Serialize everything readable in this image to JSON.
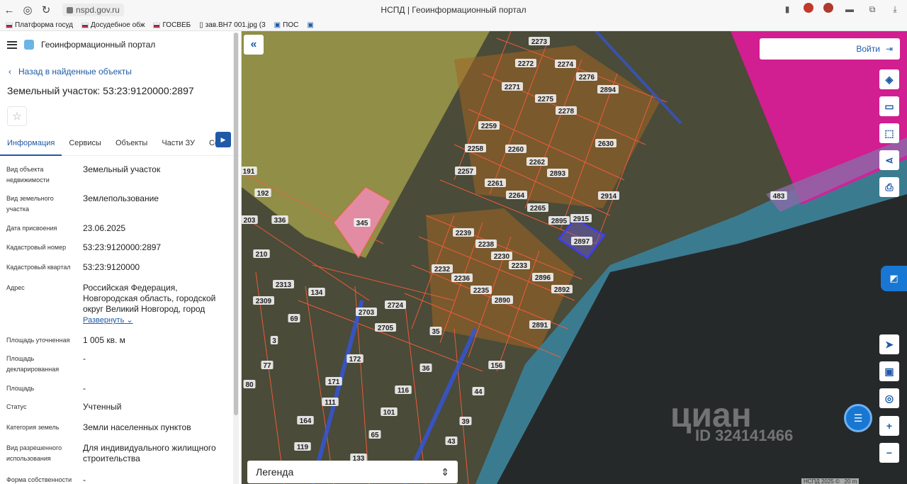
{
  "browser": {
    "url": "nspd.gov.ru",
    "title": "НСПД | Геоинформационный портал",
    "bookmarks": [
      "Платформа госуд",
      "Досудебное обж",
      "ГОСВЕБ",
      "зав.ВН7 001.jpg (3",
      "ПОС"
    ]
  },
  "app": {
    "title": "Геоинформационный портал",
    "back_label": "Назад в найденные объекты",
    "object_title": "Земельный участок: 53:23:9120000:2897",
    "tabs": [
      "Информация",
      "Сервисы",
      "Объекты",
      "Части ЗУ",
      "Сост"
    ]
  },
  "properties": [
    {
      "label": "Вид объекта недвижимости",
      "value": "Земельный участок"
    },
    {
      "label": "Вид земельного участка",
      "value": "Землепользование"
    },
    {
      "label": "Дата присвоения",
      "value": "23.06.2025"
    },
    {
      "label": "Кадастровый номер",
      "value": "53:23:9120000:2897"
    },
    {
      "label": "Кадастровый квартал",
      "value": "53:23:9120000"
    },
    {
      "label": "Адрес",
      "value": "Российская Федерация, Новгородская область, городской округ Великий Новгород, город"
    },
    {
      "label": "Площадь уточненная",
      "value": "1 005 кв. м"
    },
    {
      "label": "Площадь декларированная",
      "value": "-"
    },
    {
      "label": "Площадь",
      "value": "-"
    },
    {
      "label": "Статус",
      "value": "Учтенный"
    },
    {
      "label": "Категория земель",
      "value": "Земли населенных пунктов"
    },
    {
      "label": "Вид разрешенного использования",
      "value": "Для индивидуального жилищного строительства"
    },
    {
      "label": "Форма собственности",
      "value": "-"
    }
  ],
  "expand_label": "Развернуть",
  "map": {
    "login_label": "Войти",
    "legend_label": "Легенда",
    "watermark": "циан",
    "watermark_id": "ID 324141466",
    "attribution": "НСПД 2025 ©",
    "scale": "20 m",
    "parcels": [
      "2273",
      "2272",
      "2274",
      "2276",
      "2271",
      "2275",
      "2894",
      "2278",
      "2259",
      "2630",
      "2258",
      "2260",
      "2262",
      "2257",
      "2893",
      "2261",
      "2264",
      "2914",
      "2265",
      "2895",
      "2915",
      "2897",
      "2239",
      "2238",
      "2230",
      "2232",
      "2233",
      "2896",
      "2236",
      "2235",
      "2892",
      "2890",
      "2891",
      "345",
      "192",
      "191",
      "203",
      "336",
      "210",
      "2313",
      "134",
      "2309",
      "2703",
      "2724",
      "69",
      "2705",
      "35",
      "3",
      "172",
      "156",
      "77",
      "36",
      "171",
      "116",
      "44",
      "80",
      "111",
      "101",
      "164",
      "65",
      "39",
      "119",
      "43",
      "133",
      "483"
    ],
    "selected_parcel": "2897",
    "colors": {
      "accent": "#1e5aa8",
      "selected": "#3d3dff",
      "zone_pink": "#e0199a",
      "zone_blue": "#2fa4d8"
    }
  }
}
